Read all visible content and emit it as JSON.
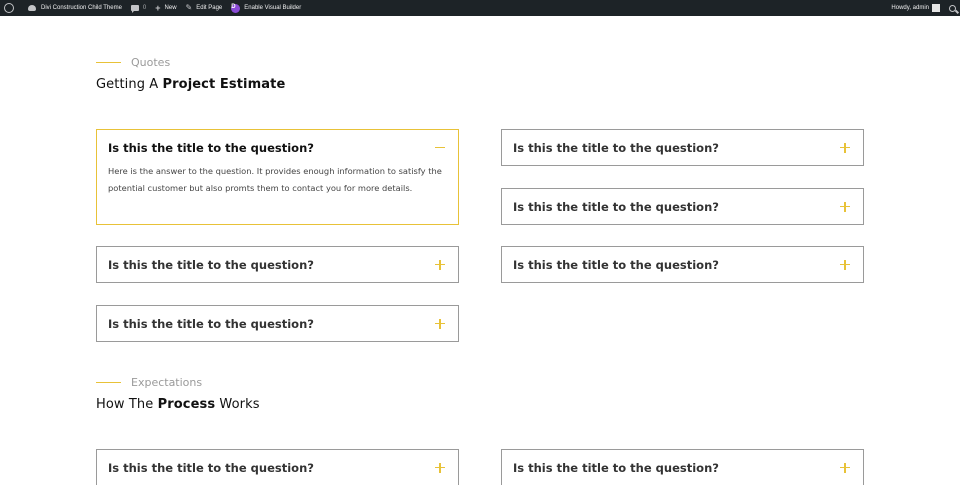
{
  "adminbar": {
    "site_name": "Divi Construction Child Theme",
    "comments": "0",
    "new": "New",
    "edit_page": "Edit Page",
    "visual_builder": "Enable Visual Builder",
    "howdy": "Howdy, admin"
  },
  "sections": [
    {
      "eyebrow": "Quotes",
      "title_prefix": "Getting A",
      "title_bold": "Project Estimate"
    },
    {
      "eyebrow": "Expectations",
      "title_prefix": "How The",
      "title_bold": "Process",
      "title_suffix": "Works"
    }
  ],
  "accent_color": "#e8c238",
  "faq": {
    "q1": "Is this the title to the question?",
    "a1": "Here is the answer to the question. It provides enough information to satisfy the potential customer but also promts them to contact you for more details.",
    "q2": "Is this the title to the question?",
    "q3": "Is this the title to the question?",
    "q4": "Is this the title to the question?",
    "q5": "Is this the title to the question?",
    "q6": "Is this the title to the question?",
    "q7": "Is this the title to the question?",
    "q8": "Is this the title to the question?"
  }
}
